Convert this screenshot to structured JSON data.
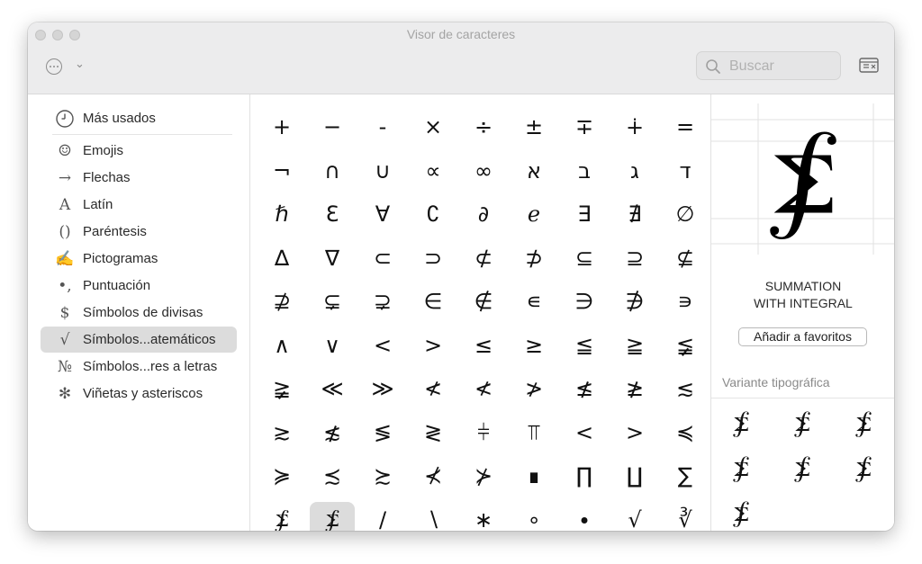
{
  "window": {
    "title": "Visor de caracteres",
    "search_placeholder": "Buscar"
  },
  "sidebar": {
    "items": [
      {
        "label": "Más usados",
        "icon": "clock-icon",
        "glyph": ""
      },
      {
        "label": "Emojis",
        "icon": "smiley-icon",
        "glyph": "☺"
      },
      {
        "label": "Flechas",
        "icon": "arrow-icon",
        "glyph": "→"
      },
      {
        "label": "Latín",
        "icon": "latin-letter-icon",
        "glyph": "A"
      },
      {
        "label": "Paréntesis",
        "icon": "parentheses-icon",
        "glyph": "()"
      },
      {
        "label": "Pictogramas",
        "icon": "pictogram-icon",
        "glyph": "✍"
      },
      {
        "label": "Puntuación",
        "icon": "punctuation-icon",
        "glyph": "•,"
      },
      {
        "label": "Símbolos de divisas",
        "icon": "currency-icon",
        "glyph": "$"
      },
      {
        "label": "Símbolos...atemáticos",
        "icon": "math-root-icon",
        "glyph": "√",
        "selected": true
      },
      {
        "label": "Símbolos...res a letras",
        "icon": "numero-sign-icon",
        "glyph": "№"
      },
      {
        "label": "Viñetas y asteriscos",
        "icon": "asterisk-icon",
        "glyph": "✻"
      }
    ]
  },
  "grid": {
    "rows": [
      [
        "+",
        "−",
        "-",
        "×",
        "÷",
        "±",
        "∓",
        "∔",
        "="
      ],
      [
        "¬",
        "∩",
        "∪",
        "∝",
        "∞",
        "א",
        "ב",
        "ג",
        "ד"
      ],
      [
        "ℏ",
        "Ɛ",
        "∀",
        "∁",
        "∂",
        "ℯ",
        "∃",
        "∄",
        "∅"
      ],
      [
        "∆",
        "∇",
        "⊂",
        "⊃",
        "⊄",
        "⊅",
        "⊆",
        "⊇",
        "⊈"
      ],
      [
        "⊉",
        "⊊",
        "⊋",
        "∈",
        "∉",
        "∊",
        "∋",
        "∌",
        "∍"
      ],
      [
        "∧",
        "∨",
        "<",
        ">",
        "≤",
        "≥",
        "≦",
        "≧",
        "≨"
      ],
      [
        "≩",
        "≪",
        "≫",
        "≮",
        "≮",
        "≯",
        "≰",
        "≱",
        "≲"
      ],
      [
        "≳",
        "≴",
        "≶",
        "≷",
        "⫩",
        "⫪",
        "<",
        ">",
        "≼"
      ],
      [
        "≽",
        "≾",
        "≿",
        "⊀",
        "⊁",
        "∎",
        "∏",
        "∐",
        "∑"
      ],
      [
        "⨋",
        "⨋",
        "/",
        "∖",
        "∗",
        "∘",
        "∙",
        "√",
        "∛"
      ]
    ],
    "selected_index": 82
  },
  "detail": {
    "glyph": "⨋",
    "name_line1": "SUMMATION",
    "name_line2": "WITH INTEGRAL",
    "favorite_button": "Añadir a favoritos",
    "variant_title": "Variante tipográfica",
    "variants": [
      "⨋",
      "⨋",
      "⨋",
      "⨋",
      "⨋",
      "⨋",
      "⨋"
    ]
  }
}
